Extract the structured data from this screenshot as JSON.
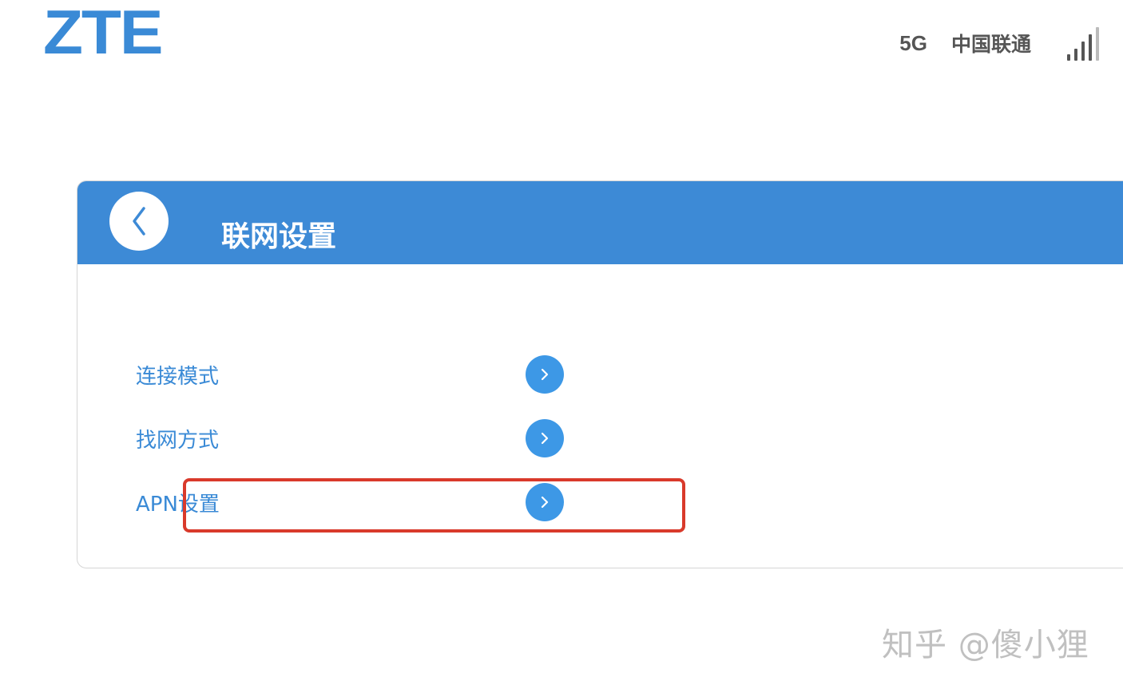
{
  "header": {
    "logo_text": "ZTE",
    "network_type": "5G",
    "carrier": "中国联通",
    "signal_icon": "signal-strength-icon"
  },
  "card": {
    "back_icon": "chevron-left-icon",
    "title": "联网设置",
    "items": [
      {
        "label": "连接模式",
        "icon": "chevron-right-icon"
      },
      {
        "label": "找网方式",
        "icon": "chevron-right-icon"
      },
      {
        "label": "APN设置",
        "icon": "chevron-right-icon",
        "highlighted": true
      }
    ]
  },
  "watermark": "知乎 @傻小狸",
  "colors": {
    "brand_blue": "#3d8ad6",
    "arrow_blue": "#3d98e6",
    "highlight_red": "#d93a2b"
  }
}
